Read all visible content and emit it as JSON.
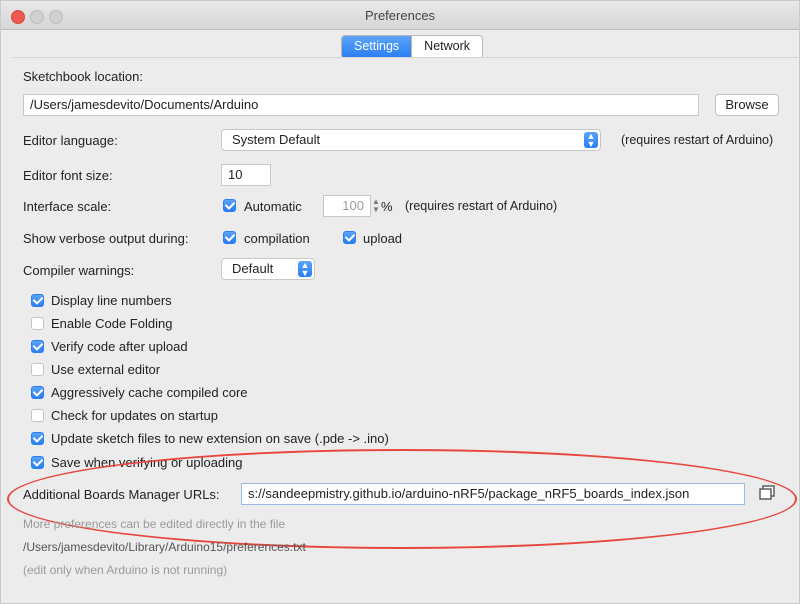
{
  "window": {
    "title": "Preferences"
  },
  "tabs": [
    {
      "label": "Settings",
      "active": true
    },
    {
      "label": "Network",
      "active": false
    }
  ],
  "sketchbook": {
    "label": "Sketchbook location:",
    "value": "/Users/jamesdevito/Documents/Arduino",
    "browse_label": "Browse"
  },
  "editor_language": {
    "label": "Editor language:",
    "value": "System Default",
    "note": "(requires restart of Arduino)"
  },
  "editor_font_size": {
    "label": "Editor font size:",
    "value": "10"
  },
  "interface_scale": {
    "label": "Interface scale:",
    "automatic_label": "Automatic",
    "automatic_checked": true,
    "value": "100",
    "unit": "%",
    "note": "(requires restart of Arduino)"
  },
  "verbose_output": {
    "label": "Show verbose output during:",
    "compilation_label": "compilation",
    "compilation_checked": true,
    "upload_label": "upload",
    "upload_checked": true
  },
  "compiler_warnings": {
    "label": "Compiler warnings:",
    "value": "Default"
  },
  "options": [
    {
      "label": "Display line numbers",
      "checked": true
    },
    {
      "label": "Enable Code Folding",
      "checked": false
    },
    {
      "label": "Verify code after upload",
      "checked": true
    },
    {
      "label": "Use external editor",
      "checked": false
    },
    {
      "label": "Aggressively cache compiled core",
      "checked": true
    },
    {
      "label": "Check for updates on startup",
      "checked": false
    },
    {
      "label": "Update sketch files to new extension on save (.pde -> .ino)",
      "checked": true
    },
    {
      "label": "Save when verifying or uploading",
      "checked": true
    }
  ],
  "boards_manager": {
    "label": "Additional Boards Manager URLs:",
    "value": "s://sandeepmistry.github.io/arduino-nRF5/package_nRF5_boards_index.json"
  },
  "footer": {
    "line1": "More preferences can be edited directly in the file",
    "line2": "/Users/jamesdevito/Library/Arduino15/preferences.txt",
    "line3": "(edit only when Arduino is not running)"
  },
  "colors": {
    "accent": "#2a7ef2",
    "highlight_oval": "#e8453c"
  }
}
